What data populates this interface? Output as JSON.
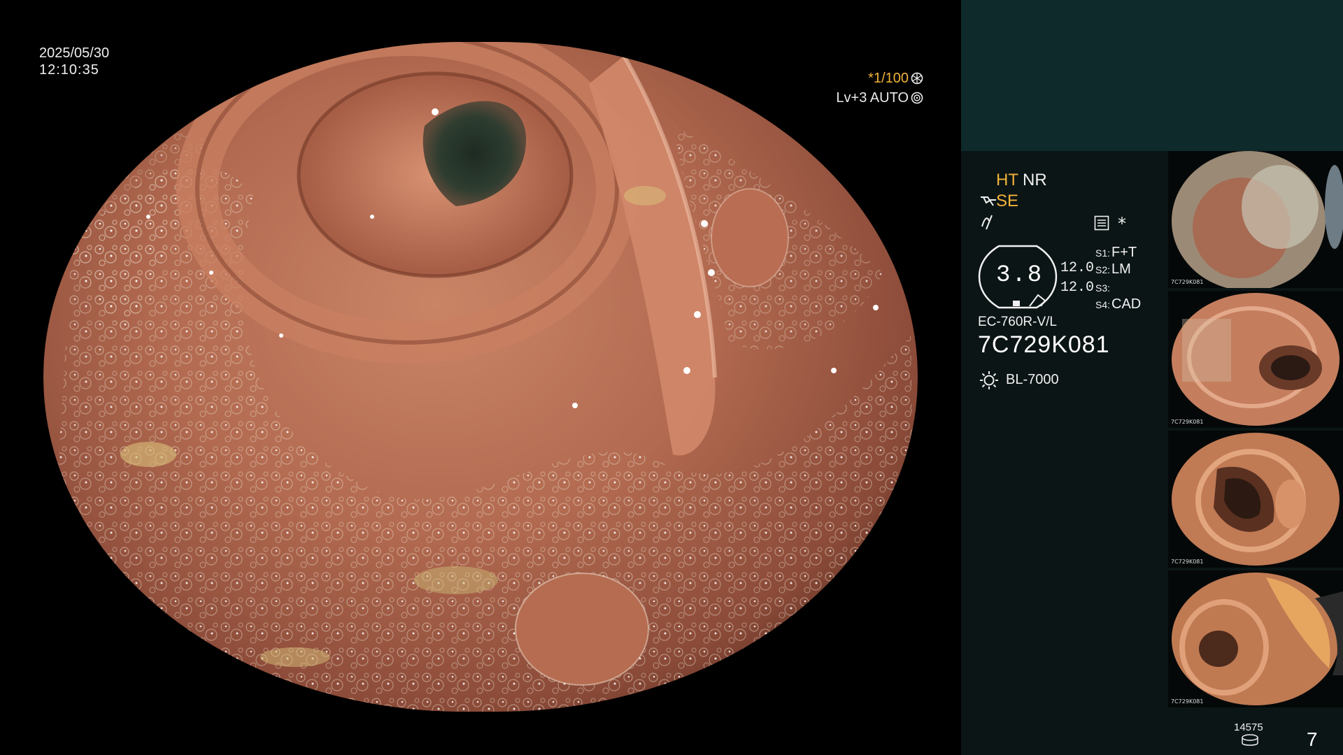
{
  "scope_area": {
    "date": "2025/05/30",
    "time": "12:10:35",
    "shutter": "*1/100",
    "level": "Lv+3 AUTO",
    "shutter_icon": "aperture-icon",
    "level_icon": "auto-iris-icon"
  },
  "side_panel": {
    "modes": {
      "ht": "HT",
      "nr": "NR",
      "se": "SE",
      "se_icon": "structure-enhance-icon",
      "wave_icon": "color-enhance-icon",
      "menu_icon": "menu-list-icon",
      "star": "*"
    },
    "zoom": {
      "value": "3.8",
      "a": "12.0",
      "b": "12.0"
    },
    "switches": [
      {
        "key": "S1:",
        "value": "F+T"
      },
      {
        "key": "S2:",
        "value": "LM"
      },
      {
        "key": "S3:",
        "value": ""
      },
      {
        "key": "S4:",
        "value": "CAD"
      }
    ],
    "scope_model": "EC-760R-V/L",
    "scope_serial": "7C729K081",
    "light_source": "BL-7000",
    "light_icon": "light-source-icon",
    "storage_count": "14575",
    "storage_icon": "storage-disk-icon",
    "image_count": "7"
  },
  "thumbnails": [
    {
      "caption": "7C729K081"
    },
    {
      "caption": "7C729K081"
    },
    {
      "caption": "7C729K081"
    },
    {
      "caption": "7C729K081"
    }
  ],
  "colors": {
    "accent_orange": "#f2b23a",
    "panel_top": "#0e2a2a",
    "panel_bottom": "#0b1515",
    "mucosa": "#b8735a",
    "lumen": "#2a3a2e"
  }
}
